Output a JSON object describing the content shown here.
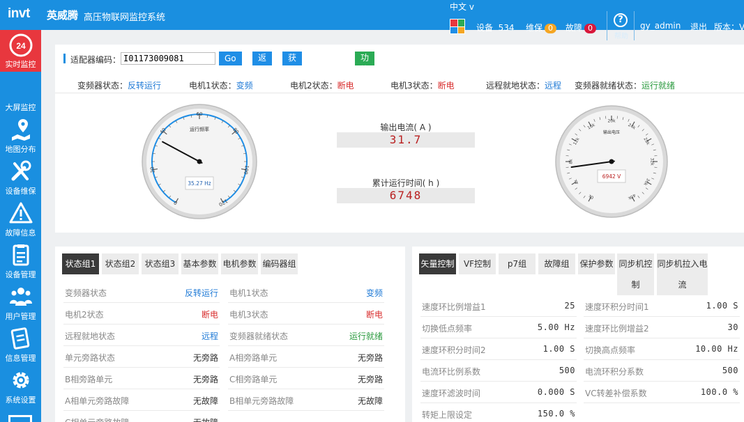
{
  "header": {
    "logo": "invt",
    "logo_cn": "英威腾",
    "system_title": "高压物联网监控系统",
    "language": "中文 v",
    "device_label": "设备",
    "device_count": "534",
    "maint_label": "维保",
    "maint_count": "0",
    "fault_label": "故障",
    "fault_count": "0",
    "help_label": "帮助",
    "help_glyph": "?",
    "user": "gy_admin",
    "logout": "退出",
    "version": "版本：V"
  },
  "sidebar": {
    "items": [
      {
        "label": "实时监控",
        "badge": "24"
      },
      {
        "label": "大屏监控"
      },
      {
        "label": "地图分布"
      },
      {
        "label": "设备维保"
      },
      {
        "label": "故障信息"
      },
      {
        "label": "设备管理"
      },
      {
        "label": "用户管理"
      },
      {
        "label": "信息管理"
      },
      {
        "label": "系统设置"
      }
    ]
  },
  "filter": {
    "label": "适配器编码：",
    "code": "I01173009081",
    "buttons": [
      "Go",
      "返回",
      "获取黑匣子数据",
      "功能码信息导出"
    ]
  },
  "status": [
    {
      "label": "变频器状态：",
      "value": "反转运行"
    },
    {
      "label": "电机1状态：",
      "value": "变频"
    },
    {
      "label": "电机2状态：",
      "value": "断电"
    },
    {
      "label": "电机3状态：",
      "value": "断电"
    },
    {
      "label": "远程就地状态：",
      "value": "远程"
    },
    {
      "label": "变频器就绪状态：",
      "value": "运行就绪"
    }
  ],
  "gauge_freq": {
    "title": "运行频率",
    "value_text": "35.27 Hz",
    "value": 35.27,
    "min": 0,
    "max": 120,
    "ticks": [
      "0",
      "20",
      "40",
      "60",
      "80",
      "100",
      "120"
    ]
  },
  "readouts": [
    {
      "label": "输出电流( A )",
      "value": "31.7"
    },
    {
      "label": "累计运行时间( h )",
      "value": "6748"
    }
  ],
  "gauge_volt": {
    "title": "输出电压",
    "value_text": "6942 V",
    "value": 6942,
    "min": 0,
    "max": 40000,
    "ticks": [
      "0k",
      "4k",
      "8k",
      "12k",
      "16k",
      "20k",
      "24k",
      "28k",
      "32k",
      "36k",
      "40k"
    ]
  },
  "tabs_left": [
    "状态组1",
    "状态组2",
    "状态组3",
    "基本参数",
    "电机参数",
    "编码器组"
  ],
  "table_left": [
    [
      "变频器状态",
      "反转运行",
      "电机1状态",
      "变频"
    ],
    [
      "电机2状态",
      "断电",
      "电机3状态",
      "断电"
    ],
    [
      "远程就地状态",
      "远程",
      "变频器就绪状态",
      "运行就绪"
    ],
    [
      "单元旁路状态",
      "无旁路",
      "A相旁路单元",
      "无旁路"
    ],
    [
      "B相旁路单元",
      "无旁路",
      "C相旁路单元",
      "无旁路"
    ],
    [
      "A相单元旁路故障",
      "无故障",
      "B相单元旁路故障",
      "无故障"
    ],
    [
      "C相单元旁路故障",
      "无故障",
      "",
      ""
    ]
  ],
  "tabs_right": [
    "矢量控制",
    "VF控制",
    "p7组",
    "故障组",
    "保护参数",
    "同步机控制",
    "同步机拉入电流"
  ],
  "table_right": [
    [
      "速度环比例增益1",
      "25",
      "速度环积分时间1",
      "1.00 S"
    ],
    [
      "切换低点频率",
      "5.00 Hz",
      "速度环比例增益2",
      "30"
    ],
    [
      "速度环积分时间2",
      "1.00 S",
      "切换高点频率",
      "10.00 Hz"
    ],
    [
      "电流环比例系数",
      "500",
      "电流环积分系数",
      "500"
    ],
    [
      "速度环滤波时间",
      "0.000 S",
      "VC转差补偿系数",
      "100.0 %"
    ],
    [
      "转矩上限设定",
      "150.0 %",
      "",
      ""
    ]
  ]
}
